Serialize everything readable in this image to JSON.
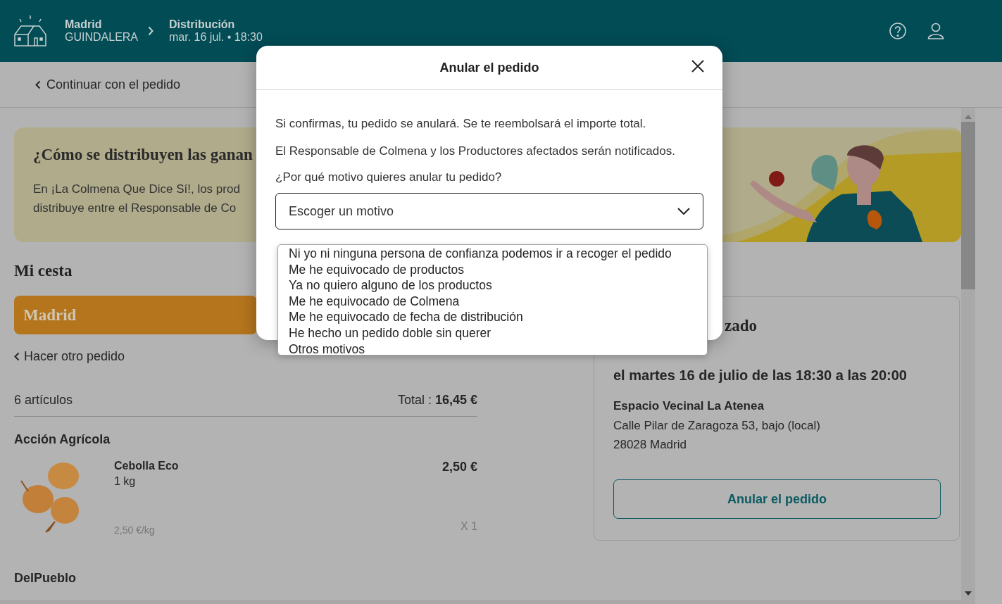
{
  "header": {
    "hive_name": "Madrid",
    "hive_area": "GUINDALERA",
    "distribution_label": "Distribución",
    "distribution_date": "mar. 16 jul. • 18:30"
  },
  "back_link": "Continuar con el pedido",
  "banner": {
    "title": "¿Cómo se distribuyen las ganan",
    "body_lines": [
      "En ¡La Colmena Que Dice Sí!, los prod",
      "distribuye entre el Responsable de Co"
    ],
    "kind": "picture"
  },
  "basket": {
    "title": "Mi cesta",
    "hive_name": "Madrid",
    "other_order_link": "Hacer otro pedido",
    "count": "6 artículos",
    "total_label": "Total :",
    "total_value": "16,45 €",
    "producers": [
      {
        "name": "Acción Agrícola",
        "items": [
          {
            "name": "Cebolla Eco",
            "unit": "1 kg",
            "unit_price": "2,50 €/kg",
            "price": "2,50 €",
            "quantity": "X 1"
          }
        ]
      },
      {
        "name": "DelPueblo"
      }
    ]
  },
  "pickup_card": {
    "title_fragment": "zado",
    "when": "el martes 16 de julio de las 18:30 a las 20:00",
    "place": "Espacio Vecinal La Atenea",
    "address_lines": [
      "Calle Pilar de Zaragoza 53, bajo (local)",
      "28028 Madrid"
    ],
    "button": "Anular el pedido"
  },
  "modal": {
    "title": "Anular el pedido",
    "paragraphs": [
      "Si confirmas, tu pedido se anulará. Se te reembolsará el importe total.",
      "El Responsable de Colmena y los Productores afectados serán notificados."
    ],
    "question": "¿Por qué motivo quieres anular tu pedido?",
    "select": {
      "placeholder": "Escoger un motivo",
      "expanded": true
    },
    "options": [
      {
        "label": "Ni yo ni ninguna persona de confianza podemos ir a recoger el pedido",
        "selected": false
      },
      {
        "label": "Me he equivocado de productos",
        "selected": false
      },
      {
        "label": "Ya no quiero alguno de los productos",
        "selected": false
      },
      {
        "label": "Me he equivocado de Colmena",
        "selected": false
      },
      {
        "label": "Me he equivocado de fecha de distribución",
        "selected": false
      },
      {
        "label": "He hecho un pedido doble sin querer",
        "selected": false
      },
      {
        "label": "Otros motivos",
        "selected": false
      }
    ]
  }
}
